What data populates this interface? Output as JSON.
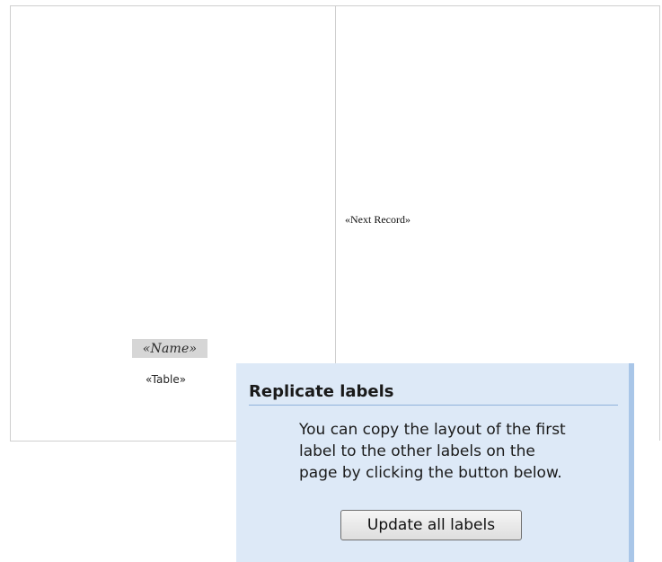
{
  "document": {
    "name_field": "«Name»",
    "table_field": "«Table»",
    "next_record_field": "«Next Record»"
  },
  "replicate_pane": {
    "title": "Replicate labels",
    "description": "You can copy the layout of the first\nlabel to the other labels on the\npage by clicking the button below.",
    "button_label": "Update all labels"
  }
}
